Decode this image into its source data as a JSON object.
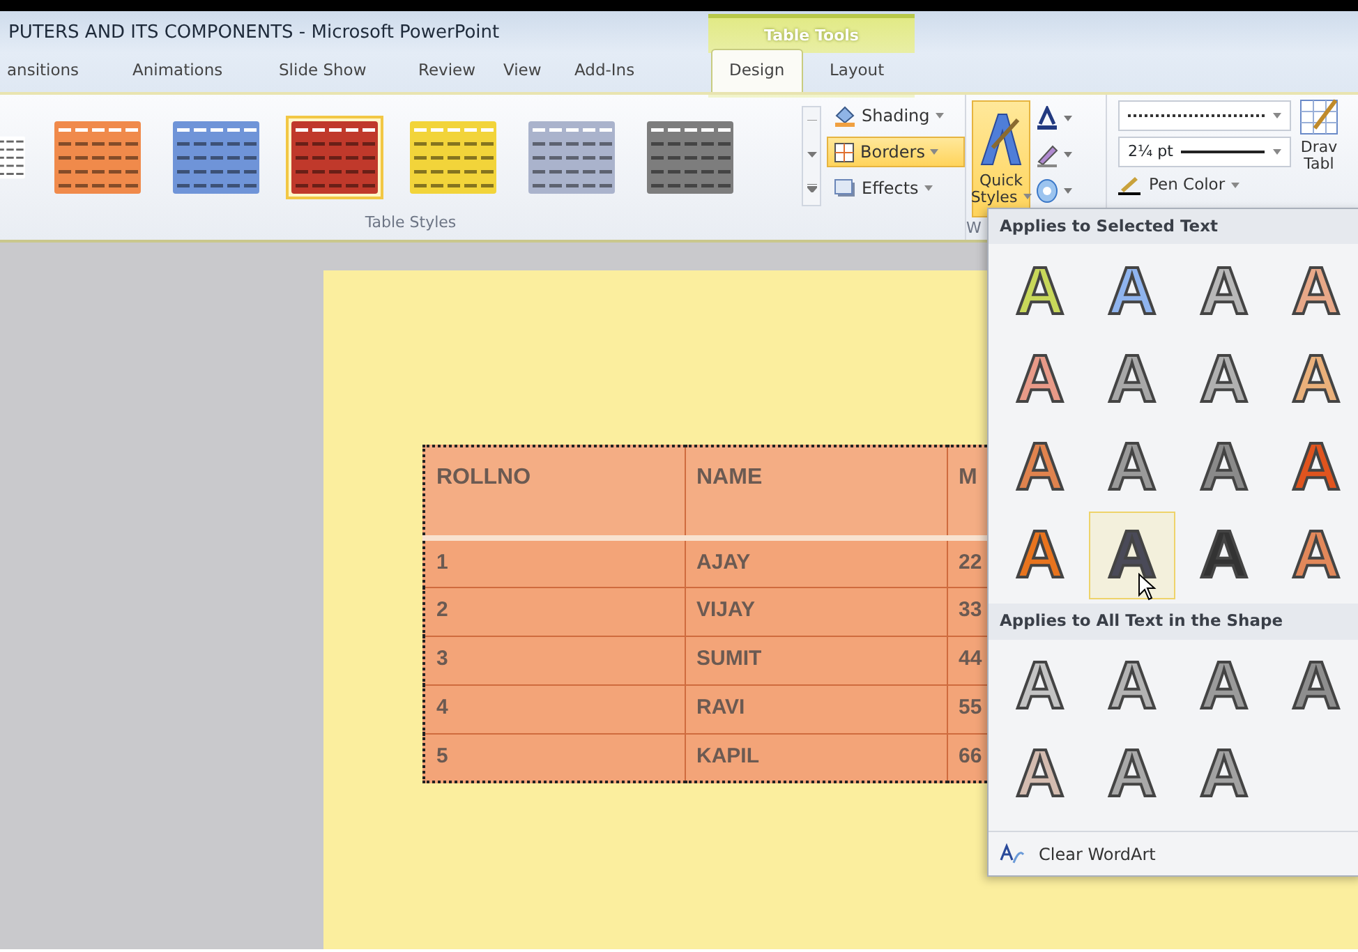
{
  "window": {
    "title": "PUTERS AND ITS COMPONENTS  -  Microsoft PowerPoint"
  },
  "contextual_group": {
    "label": "Table Tools"
  },
  "tabs": [
    {
      "label": "ansitions",
      "selected": false
    },
    {
      "label": "Animations",
      "selected": false
    },
    {
      "label": "Slide Show",
      "selected": false
    },
    {
      "label": "Review",
      "selected": false
    },
    {
      "label": "View",
      "selected": false
    },
    {
      "label": "Add-Ins",
      "selected": false
    },
    {
      "label": "Design",
      "selected": true
    },
    {
      "label": "Layout",
      "selected": false
    }
  ],
  "table_styles": {
    "label": "Table Styles",
    "swatches": [
      {
        "color": "#ffffff",
        "selected": false
      },
      {
        "color": "#f08a4b",
        "selected": false
      },
      {
        "color": "#6f94d8",
        "selected": false
      },
      {
        "color": "#c0392b",
        "selected": true
      },
      {
        "color": "#f2d43a",
        "selected": false
      },
      {
        "color": "#aab3cc",
        "selected": false
      },
      {
        "color": "#7d7d7d",
        "selected": false
      }
    ]
  },
  "shading_group": [
    {
      "kind": "shading",
      "label": "Shading",
      "highlighted": false
    },
    {
      "kind": "borders",
      "label": "Borders",
      "highlighted": true
    },
    {
      "kind": "effects",
      "label": "Effects",
      "highlighted": false
    }
  ],
  "wordart_group": {
    "label": "W",
    "quick_styles": {
      "lines": [
        "Quick",
        "Styles"
      ],
      "highlighted": true
    }
  },
  "draw_borders": {
    "pen_weight": "2¼ pt",
    "pen_color": "Pen Color",
    "draw_table": [
      "Drav",
      "Tabl"
    ]
  },
  "slide_table": {
    "columns": [
      "ROLLNO",
      "NAME",
      "M"
    ],
    "rows": [
      [
        "1",
        "AJAY",
        "22"
      ],
      [
        "2",
        "VIJAY",
        "33"
      ],
      [
        "3",
        "SUMIT",
        "44"
      ],
      [
        "4",
        "RAVI",
        "55"
      ],
      [
        "5",
        "KAPIL",
        "66"
      ]
    ]
  },
  "quick_styles_menu": {
    "sections": [
      {
        "heading": "Applies to Selected Text",
        "styles": [
          {
            "glyph": "A",
            "color": "#c8d85a",
            "selected": false
          },
          {
            "glyph": "A",
            "color": "#8fb4ee",
            "selected": false
          },
          {
            "glyph": "A",
            "color": "#b8b8b8",
            "selected": false
          },
          {
            "glyph": "A",
            "color": "#e8a888",
            "selected": false
          },
          {
            "glyph": "A",
            "color": "#e89a88",
            "selected": false
          },
          {
            "glyph": "A",
            "color": "#a8a8a8",
            "selected": false
          },
          {
            "glyph": "A",
            "color": "#b0b0b0",
            "selected": false
          },
          {
            "glyph": "A",
            "color": "#eab07a",
            "selected": false
          },
          {
            "glyph": "A",
            "color": "#e0834e",
            "selected": false
          },
          {
            "glyph": "A",
            "color": "#9a9a9a",
            "selected": false
          },
          {
            "glyph": "A",
            "color": "#8a8a8a",
            "selected": false
          },
          {
            "glyph": "A",
            "color": "#e0541e",
            "selected": false
          },
          {
            "glyph": "A",
            "color": "#e8741e",
            "selected": false
          },
          {
            "glyph": "A",
            "color": "#4a4a58",
            "selected": true
          },
          {
            "glyph": "A",
            "color": "#333333",
            "selected": false
          },
          {
            "glyph": "A",
            "color": "#e2885a",
            "selected": false
          }
        ]
      },
      {
        "heading": "Applies to All Text in the Shape",
        "styles": [
          {
            "glyph": "A",
            "color": "#c4c4c4",
            "selected": false
          },
          {
            "glyph": "A",
            "color": "#b4b4b4",
            "selected": false
          },
          {
            "glyph": "A",
            "color": "#9b9b9b",
            "selected": false
          },
          {
            "glyph": "A",
            "color": "#8e8e8e",
            "selected": false
          },
          {
            "glyph": "A",
            "color": "#d4bcb0",
            "selected": false
          },
          {
            "glyph": "A",
            "color": "#a9a9a9",
            "selected": false
          },
          {
            "glyph": "A",
            "color": "#a2a2a2",
            "selected": false
          }
        ]
      }
    ],
    "footer": "Clear WordArt"
  }
}
